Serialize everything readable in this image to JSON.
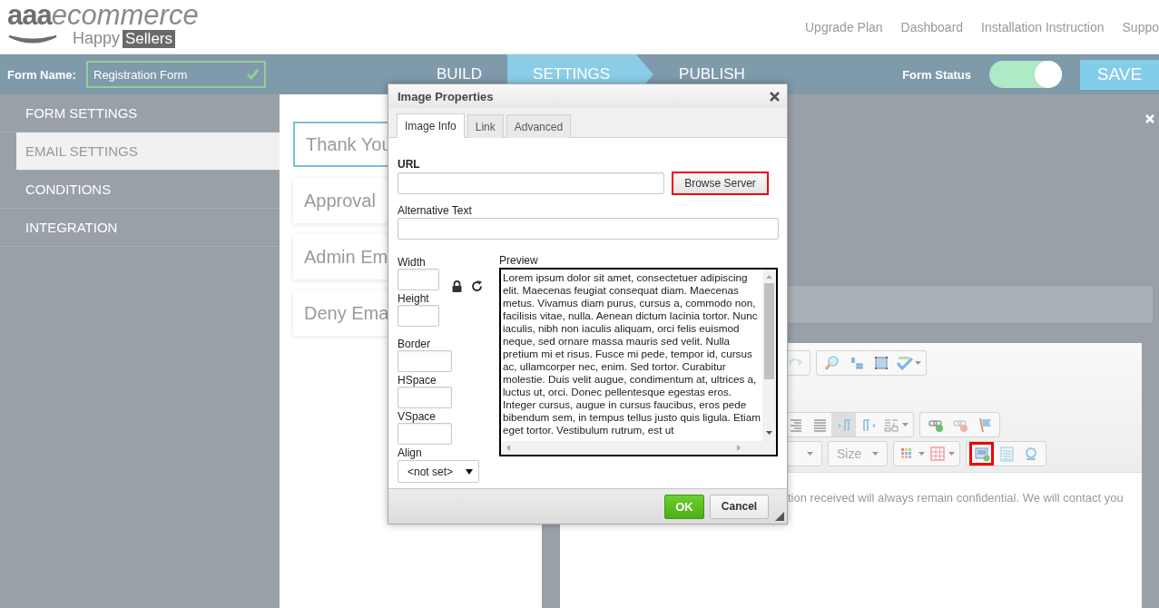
{
  "header": {
    "logo": {
      "brand": "aaa",
      "brand_rest": "ecommerce",
      "tagline": "Happy",
      "tagline_badge": "Sellers"
    },
    "nav": [
      "Upgrade Plan",
      "Dashboard",
      "Installation Instruction",
      "Suppo"
    ]
  },
  "topbar": {
    "form_name_label": "Form Name:",
    "form_name": "Registration Form",
    "valid": true,
    "steps": [
      {
        "label": "BUILD",
        "selected": false
      },
      {
        "label": "SETTINGS",
        "selected": true
      },
      {
        "label": "PUBLISH",
        "selected": false
      }
    ],
    "status_label": "Form Status",
    "status_on": true,
    "save": "SAVE"
  },
  "sidebar": {
    "items": [
      {
        "label": "FORM SETTINGS",
        "selected": false
      },
      {
        "label": "EMAIL SETTINGS",
        "selected": true
      },
      {
        "label": "CONDITIONS",
        "selected": false
      },
      {
        "label": "INTEGRATION",
        "selected": false
      }
    ]
  },
  "email_templates": [
    {
      "label": "Thank You",
      "selected": true
    },
    {
      "label": "Approval",
      "selected": false
    },
    {
      "label": "Admin Em",
      "selected": false
    },
    {
      "label": "Deny Ema",
      "selected": false
    }
  ],
  "editor": {
    "toolbar_rows": [
      {
        "groups": [
          [
            {
              "kind": "redo",
              "pressed": false,
              "highlighted": false
            }
          ],
          [
            {
              "kind": "find",
              "pressed": false,
              "highlighted": false
            },
            {
              "kind": "replace",
              "pressed": false,
              "highlighted": false
            },
            {
              "kind": "selectall",
              "pressed": false,
              "highlighted": false
            },
            {
              "kind": "spellcheck",
              "pressed": false,
              "highlighted": false
            }
          ]
        ]
      },
      {
        "groups": [
          [
            {
              "kind": "alignright",
              "pressed": false,
              "highlighted": false
            },
            {
              "kind": "justify",
              "pressed": false,
              "highlighted": false
            },
            {
              "kind": "ltr",
              "pressed": true,
              "highlighted": false
            },
            {
              "kind": "rtl",
              "pressed": false,
              "highlighted": false
            },
            {
              "kind": "language",
              "pressed": false,
              "highlighted": false
            }
          ],
          [
            {
              "kind": "link",
              "pressed": false,
              "highlighted": false
            },
            {
              "kind": "unlink",
              "pressed": false,
              "highlighted": false
            },
            {
              "kind": "anchor",
              "pressed": false,
              "highlighted": false
            }
          ]
        ]
      },
      {
        "groups": [
          [
            {
              "kind": "dropdown"
            }
          ],
          [
            {
              "kind": "dropdown",
              "label": "Size"
            }
          ],
          [
            {
              "kind": "textcolor",
              "pressed": false,
              "highlighted": false
            },
            {
              "kind": "table",
              "pressed": false,
              "highlighted": false
            }
          ],
          [
            {
              "kind": "image",
              "pressed": false,
              "highlighted": true
            },
            {
              "kind": "iframe",
              "pressed": false,
              "highlighted": false
            },
            {
              "kind": "specialchar",
              "pressed": false,
              "highlighted": false
            }
          ]
        ]
      }
    ],
    "content": "tion received will always remain confidential. We will contact you"
  },
  "dialog": {
    "title": "Image Properties",
    "tabs": [
      {
        "label": "Image Info",
        "selected": true
      },
      {
        "label": "Link",
        "selected": false
      },
      {
        "label": "Advanced",
        "selected": false
      }
    ],
    "url_label": "URL",
    "browse": {
      "label": "Browse Server",
      "highlighted": true
    },
    "alt_label": "Alternative Text",
    "width_label": "Width",
    "height_label": "Height",
    "border_label": "Border",
    "hspace_label": "HSpace",
    "vspace_label": "VSpace",
    "align_label": "Align",
    "align_value": "<not set>",
    "preview_label": "Preview",
    "preview_text": "Lorem ipsum dolor sit amet, consectetuer adipiscing elit. Maecenas feugiat consequat diam. Maecenas metus. Vivamus diam purus, cursus a, commodo non, facilisis vitae, nulla. Aenean dictum lacinia tortor. Nunc iaculis, nibh non iaculis aliquam, orci felis euismod neque, sed ornare massa mauris sed velit. Nulla pretium mi et risus. Fusce mi pede, tempor id, cursus ac, ullamcorper nec, enim. Sed tortor. Curabitur molestie. Duis velit augue, condimentum at, ultrices a, luctus ut, orci. Donec pellentesque egestas eros. Integer cursus, augue in cursus faucibus, eros pede bibendum sem, in tempus tellus justo quis ligula. Etiam eget tortor. Vestibulum rutrum, est ut",
    "ok": "OK",
    "cancel": "Cancel"
  }
}
